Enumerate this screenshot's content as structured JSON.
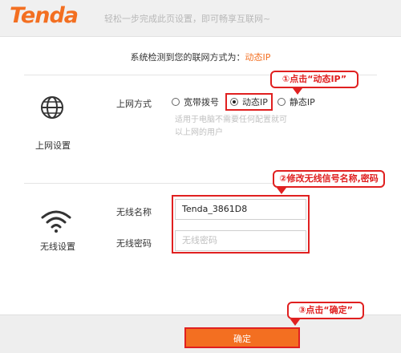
{
  "header": {
    "logo": "Tenda",
    "slogan": "轻松一步完成此页设置，即可畅享互联网~"
  },
  "detect": {
    "prefix": "系统检测到您的联网方式为：",
    "mode": "动态IP"
  },
  "internet_section": {
    "icon": "globe-icon",
    "label": "上网设置",
    "field_label": "上网方式",
    "options": [
      {
        "label": "宽带拨号",
        "selected": false
      },
      {
        "label": "动态IP",
        "selected": true
      },
      {
        "label": "静态IP",
        "selected": false
      }
    ],
    "hint_line1": "适用于电脑不需要任何配置就可",
    "hint_line2": "以上网的用户"
  },
  "wireless_section": {
    "icon": "wifi-icon",
    "label": "无线设置",
    "name_label": "无线名称",
    "name_value": "Tenda_3861D8",
    "password_label": "无线密码",
    "password_placeholder": "无线密码"
  },
  "callouts": {
    "step1": "①点击“动态IP”",
    "step2": "②修改无线信号名称,密码",
    "step3": "③点击“确定”"
  },
  "footer": {
    "ok_label": "确定"
  },
  "colors": {
    "brand_orange": "#f36f21",
    "annotation_red": "#e02020"
  }
}
